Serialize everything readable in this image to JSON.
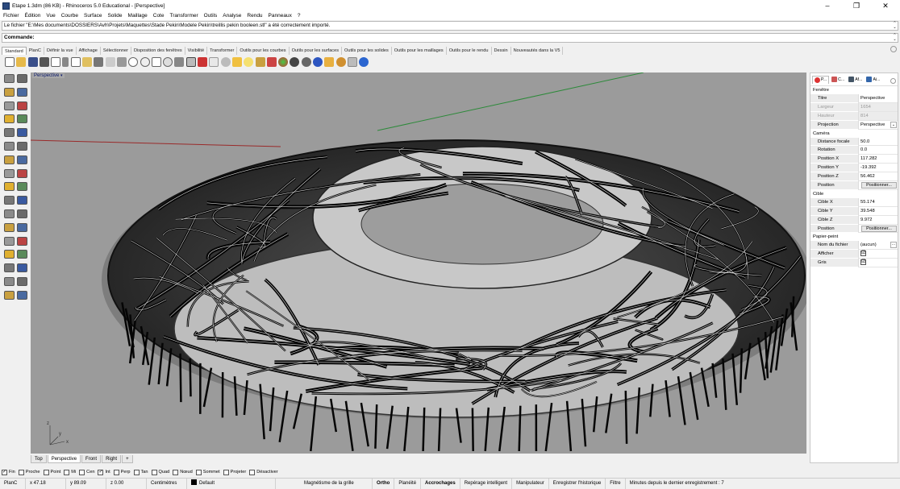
{
  "window": {
    "title": "Etape 1.3dm (86 KB) - Rhinoceros 5.0 Educational - [Perspective]",
    "controls": [
      "–",
      "❐",
      "✕"
    ]
  },
  "menu": [
    "Fichier",
    "Édition",
    "Vue",
    "Courbe",
    "Surface",
    "Solide",
    "Maillage",
    "Cote",
    "Transformer",
    "Outils",
    "Analyse",
    "Rendu",
    "Panneaux",
    "?"
  ],
  "command_history": "Le fichier \"E:\\Mes documents\\DOSSIERS\\Avh\\Projets\\Maquettes\\Stade Pekin\\Modele Pekin\\treillis pekin booleen.stl\" a été correctement importé.",
  "command_prompt": "Commande:",
  "toolbar_tabs": [
    "Standard",
    "PlanC",
    "Définir la vue",
    "Affichage",
    "Sélectionner",
    "Disposition des fenêtres",
    "Visibilité",
    "Transformer",
    "Outils pour les courbes",
    "Outils pour les surfaces",
    "Outils pour les solides",
    "Outils pour les maillages",
    "Outils  pour le rendu",
    "Dessin",
    "Nouveautés dans la V5"
  ],
  "viewport": {
    "label": "Perspective",
    "axis_x": "x",
    "axis_y": "y",
    "axis_z": "z"
  },
  "viewport_tabs": [
    "Top",
    "Perspective",
    "Front",
    "Right",
    "+"
  ],
  "panel": {
    "tabs": [
      "P...",
      "C...",
      "Af...",
      "Ai..."
    ],
    "sections": {
      "fenetre": "Fenêtre",
      "camera": "Caméra",
      "cible": "Cible",
      "papier": "Papier-peint"
    },
    "rows": {
      "titre": {
        "label": "Titre",
        "value": "Perspective"
      },
      "largeur": {
        "label": "Largeur",
        "value": "1654"
      },
      "hauteur": {
        "label": "Hauteur",
        "value": "814"
      },
      "projection": {
        "label": "Projection",
        "value": "Perspective"
      },
      "focale": {
        "label": "Distance focale",
        "value": "50.0"
      },
      "rotation": {
        "label": "Rotation",
        "value": "0.0"
      },
      "posx": {
        "label": "Position X",
        "value": "117.282"
      },
      "posy": {
        "label": "Position Y",
        "value": "-19.392"
      },
      "posz": {
        "label": "Position Z",
        "value": "56.462"
      },
      "position": {
        "label": "Position",
        "button": "Positionner..."
      },
      "ciblex": {
        "label": "Cible X",
        "value": "55.174"
      },
      "cibley": {
        "label": "Cible Y",
        "value": "39.548"
      },
      "ciblez": {
        "label": "Cible Z",
        "value": "9.972"
      },
      "position2": {
        "label": "Position",
        "button": "Positionner..."
      },
      "fichier": {
        "label": "Nom du fichier",
        "value": "(aucun)",
        "button": "..."
      },
      "afficher": {
        "label": "Afficher",
        "checked": "☑"
      },
      "gris": {
        "label": "Gris",
        "checked": "☑"
      }
    }
  },
  "osnaps": [
    {
      "label": "Fin",
      "checked": true
    },
    {
      "label": "Proche",
      "checked": false
    },
    {
      "label": "Point",
      "checked": false
    },
    {
      "label": "Mi",
      "checked": false
    },
    {
      "label": "Cen",
      "checked": false
    },
    {
      "label": "Int",
      "checked": true
    },
    {
      "label": "Perp",
      "checked": false
    },
    {
      "label": "Tan",
      "checked": false
    },
    {
      "label": "Quad",
      "checked": false
    },
    {
      "label": "Nœud",
      "checked": false
    },
    {
      "label": "Sommet",
      "checked": false
    },
    {
      "label": "Projeter",
      "checked": false
    },
    {
      "label": "Désactiver",
      "checked": false
    }
  ],
  "status": {
    "cplane": "PlanC",
    "x": "x 47.18",
    "y": "y 89.09",
    "z": "z 0.00",
    "units": "Centimètres",
    "layer": "Default",
    "grid_snap": "Magnétisme de la grille",
    "ortho": "Ortho",
    "planar": "Planéité",
    "osnap": "Accrochages",
    "smarttrack": "Repérage intelligent",
    "gumball": "Manipulateur",
    "history": "Enregistrer l'historique",
    "filter": "Filtre",
    "save_info": "Minutes depuis le dernier enregistrement : 7"
  },
  "colors": {
    "viewport_bg": "#9b9b9b",
    "mesh_dark": "#111111",
    "mesh_light": "#d8d8d8",
    "label_blue": "#0c1b6e"
  }
}
